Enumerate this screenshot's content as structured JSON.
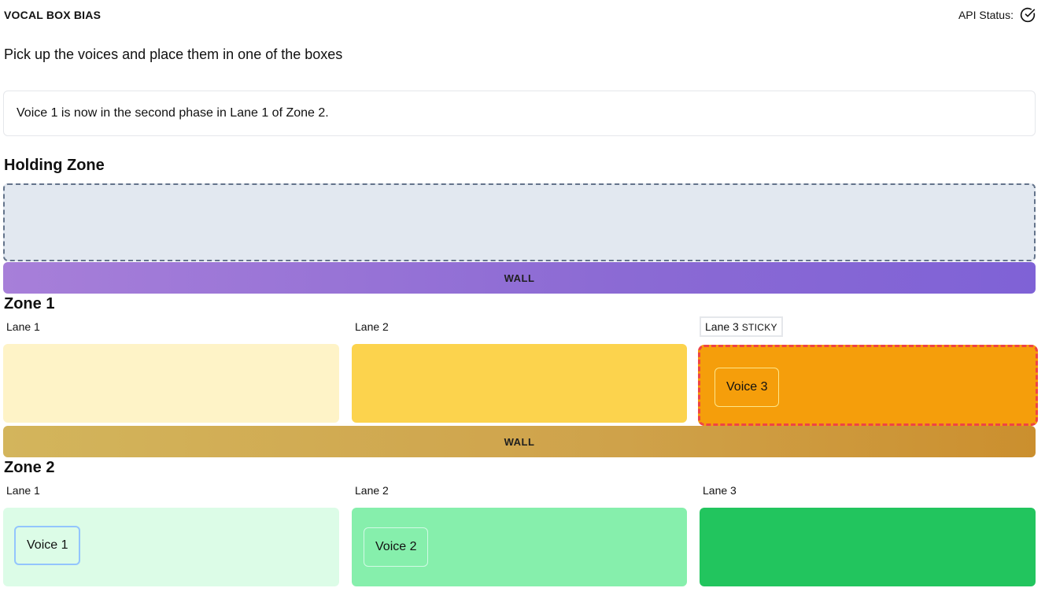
{
  "header": {
    "app_title": "VOCAL BOX BIAS",
    "api_status_label": "API Status:",
    "api_status_icon": "check-circle-icon"
  },
  "instructions": "Pick up the voices and place them in one of the boxes",
  "message": "Voice 1 is now in the second phase in Lane 1 of Zone 2.",
  "holding_zone": {
    "title": "Holding Zone"
  },
  "walls": [
    "WALL",
    "WALL"
  ],
  "zones": [
    {
      "title": "Zone 1",
      "lanes": [
        {
          "label": "Lane 1",
          "color": "#fef3c7",
          "voices": []
        },
        {
          "label": "Lane 2",
          "color": "#fcd34d",
          "voices": []
        },
        {
          "label": "Lane 3",
          "tag": "STICKY",
          "color": "#f59e0b",
          "highlight_color": "#ef4444",
          "voices": [
            "Voice 3"
          ]
        }
      ]
    },
    {
      "title": "Zone 2",
      "lanes": [
        {
          "label": "Lane 1",
          "color": "#dcfce7",
          "voices": [
            "Voice 1"
          ]
        },
        {
          "label": "Lane 2",
          "color": "#86efac",
          "voices": [
            "Voice 2"
          ]
        },
        {
          "label": "Lane 3",
          "color": "#22c55e",
          "voices": []
        }
      ]
    }
  ]
}
